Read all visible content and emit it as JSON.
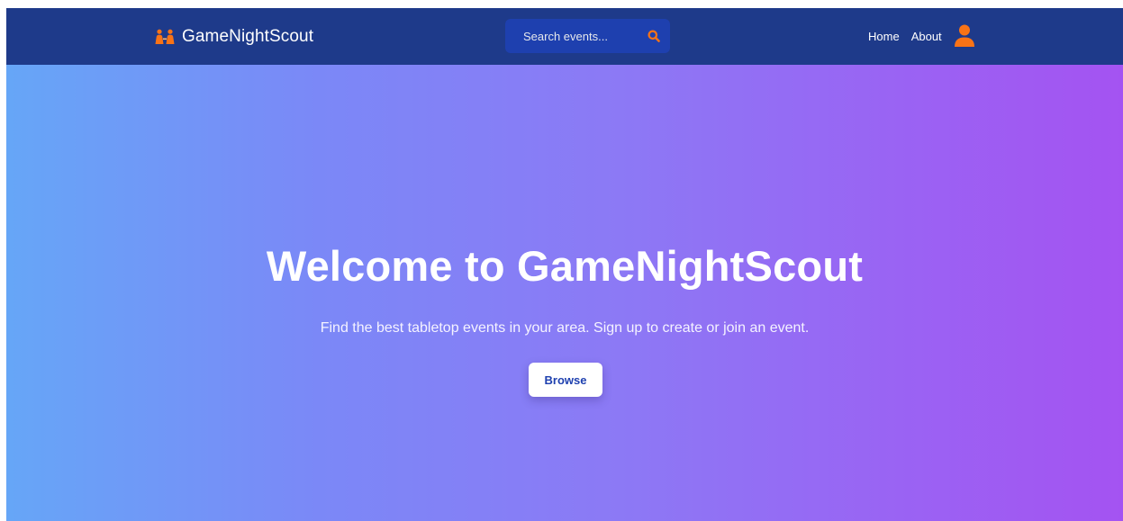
{
  "brand": {
    "name": "GameNightScout",
    "icon": "two-people-icon",
    "icon_color": "#f97316"
  },
  "search": {
    "placeholder": "Search events...",
    "value": "",
    "icon": "search-icon"
  },
  "nav": {
    "links": [
      {
        "label": "Home"
      },
      {
        "label": "About"
      }
    ],
    "avatar_icon": "user-icon"
  },
  "hero": {
    "title": "Welcome to GameNightScout",
    "subtitle": "Find the best tabletop events in your area. Sign up to create or join an event.",
    "cta_label": "Browse"
  },
  "colors": {
    "navbar_bg": "#1e3a8a",
    "search_bg": "#1e40af",
    "accent": "#f97316",
    "hero_gradient_start": "#66a6f7",
    "hero_gradient_end": "#a453f2",
    "button_text": "#1e40af"
  }
}
